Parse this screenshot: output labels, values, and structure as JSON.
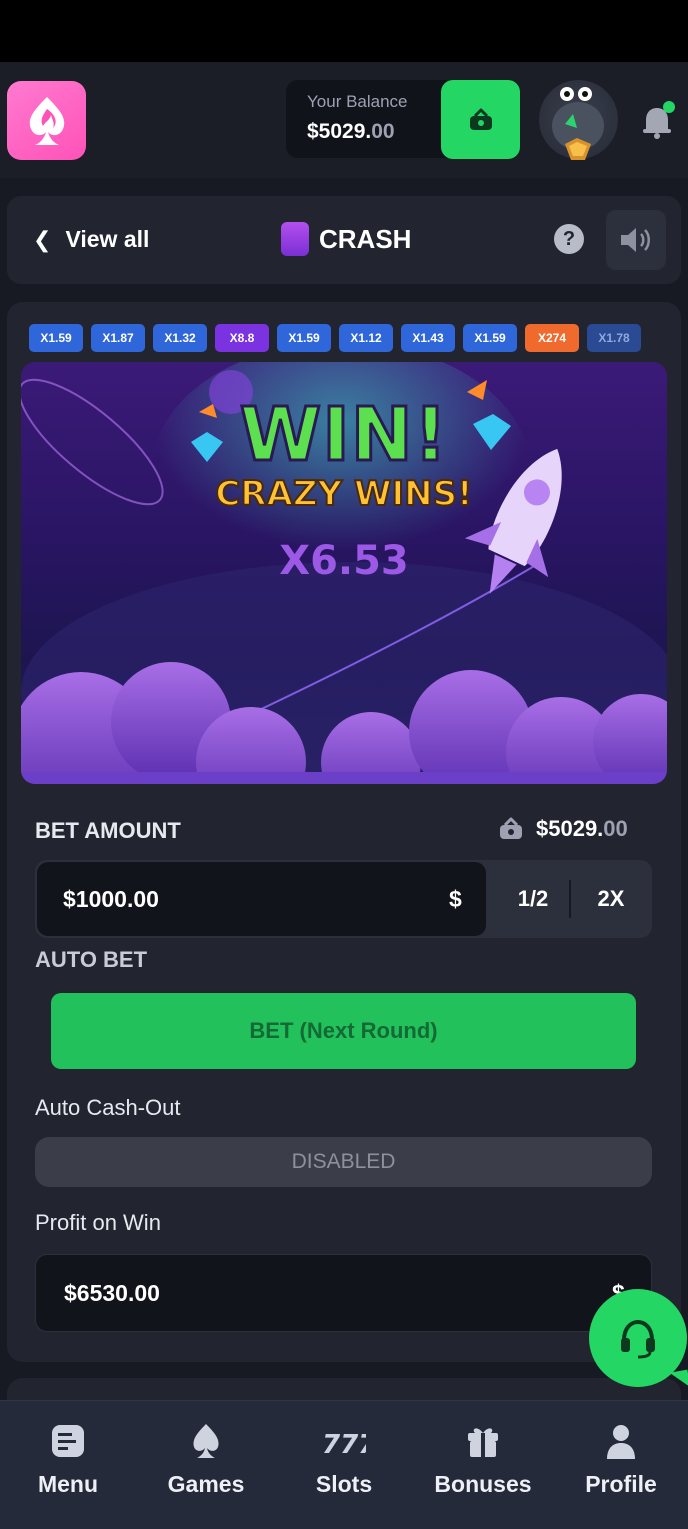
{
  "header": {
    "balance_label": "Your Balance",
    "balance_main": "$5029.",
    "balance_cents": "00"
  },
  "nav": {
    "back_label": "View all",
    "game_title": "CRASH",
    "help_label": "?"
  },
  "history": [
    {
      "label": "X1.59",
      "color": "#2f66da"
    },
    {
      "label": "X1.87",
      "color": "#2f66da"
    },
    {
      "label": "X1.32",
      "color": "#2f66da"
    },
    {
      "label": "X8.8",
      "color": "#7b32e0"
    },
    {
      "label": "X1.59",
      "color": "#2f66da"
    },
    {
      "label": "X1.12",
      "color": "#2f66da"
    },
    {
      "label": "X1.43",
      "color": "#2f66da"
    },
    {
      "label": "X1.59",
      "color": "#2f66da"
    },
    {
      "label": "X274",
      "color": "#ef6a2c"
    },
    {
      "label": "X1.78",
      "color": "#2a4a94"
    }
  ],
  "stage": {
    "win_text": "WIN!",
    "sub_text": "CRAZY WINS!",
    "multiplier": "X6.53"
  },
  "bet": {
    "label": "BET AMOUNT",
    "balance_main": "$5029.",
    "balance_cents": "00",
    "amount": "$1000.00",
    "currency_symbol": "$",
    "half_label": "1/2",
    "double_label": "2X",
    "auto_bet_label": "AUTO BET",
    "bet_button": "BET (Next Round)"
  },
  "cashout": {
    "label": "Auto Cash-Out",
    "state": "DISABLED"
  },
  "profit": {
    "label": "Profit on Win",
    "value": "$6530.00",
    "currency_symbol": "$"
  },
  "bottom_nav": [
    {
      "label": "Menu",
      "icon": "menu-icon"
    },
    {
      "label": "Games",
      "icon": "spade-icon"
    },
    {
      "label": "Slots",
      "icon": "slots-777-icon"
    },
    {
      "label": "Bonuses",
      "icon": "gift-icon"
    },
    {
      "label": "Profile",
      "icon": "person-icon"
    }
  ],
  "colors": {
    "accent_green": "#24d765",
    "brand_pink": "#ff52b8",
    "background": "#181a23",
    "panel": "#222530"
  }
}
